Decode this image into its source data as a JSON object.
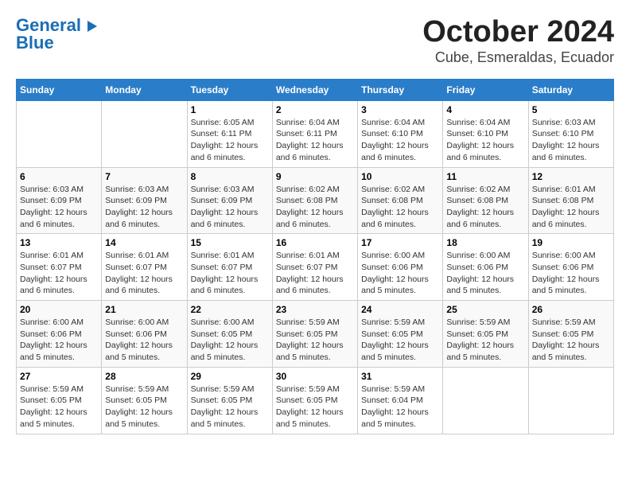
{
  "logo": {
    "line1": "General",
    "line2": "Blue"
  },
  "title": "October 2024",
  "subtitle": "Cube, Esmeraldas, Ecuador",
  "weekdays": [
    "Sunday",
    "Monday",
    "Tuesday",
    "Wednesday",
    "Thursday",
    "Friday",
    "Saturday"
  ],
  "weeks": [
    [
      null,
      null,
      {
        "day": 1,
        "sunrise": "6:05 AM",
        "sunset": "6:11 PM",
        "daylight": "12 hours and 6 minutes."
      },
      {
        "day": 2,
        "sunrise": "6:04 AM",
        "sunset": "6:11 PM",
        "daylight": "12 hours and 6 minutes."
      },
      {
        "day": 3,
        "sunrise": "6:04 AM",
        "sunset": "6:10 PM",
        "daylight": "12 hours and 6 minutes."
      },
      {
        "day": 4,
        "sunrise": "6:04 AM",
        "sunset": "6:10 PM",
        "daylight": "12 hours and 6 minutes."
      },
      {
        "day": 5,
        "sunrise": "6:03 AM",
        "sunset": "6:10 PM",
        "daylight": "12 hours and 6 minutes."
      }
    ],
    [
      {
        "day": 6,
        "sunrise": "6:03 AM",
        "sunset": "6:09 PM",
        "daylight": "12 hours and 6 minutes."
      },
      {
        "day": 7,
        "sunrise": "6:03 AM",
        "sunset": "6:09 PM",
        "daylight": "12 hours and 6 minutes."
      },
      {
        "day": 8,
        "sunrise": "6:03 AM",
        "sunset": "6:09 PM",
        "daylight": "12 hours and 6 minutes."
      },
      {
        "day": 9,
        "sunrise": "6:02 AM",
        "sunset": "6:08 PM",
        "daylight": "12 hours and 6 minutes."
      },
      {
        "day": 10,
        "sunrise": "6:02 AM",
        "sunset": "6:08 PM",
        "daylight": "12 hours and 6 minutes."
      },
      {
        "day": 11,
        "sunrise": "6:02 AM",
        "sunset": "6:08 PM",
        "daylight": "12 hours and 6 minutes."
      },
      {
        "day": 12,
        "sunrise": "6:01 AM",
        "sunset": "6:08 PM",
        "daylight": "12 hours and 6 minutes."
      }
    ],
    [
      {
        "day": 13,
        "sunrise": "6:01 AM",
        "sunset": "6:07 PM",
        "daylight": "12 hours and 6 minutes."
      },
      {
        "day": 14,
        "sunrise": "6:01 AM",
        "sunset": "6:07 PM",
        "daylight": "12 hours and 6 minutes."
      },
      {
        "day": 15,
        "sunrise": "6:01 AM",
        "sunset": "6:07 PM",
        "daylight": "12 hours and 6 minutes."
      },
      {
        "day": 16,
        "sunrise": "6:01 AM",
        "sunset": "6:07 PM",
        "daylight": "12 hours and 6 minutes."
      },
      {
        "day": 17,
        "sunrise": "6:00 AM",
        "sunset": "6:06 PM",
        "daylight": "12 hours and 5 minutes."
      },
      {
        "day": 18,
        "sunrise": "6:00 AM",
        "sunset": "6:06 PM",
        "daylight": "12 hours and 5 minutes."
      },
      {
        "day": 19,
        "sunrise": "6:00 AM",
        "sunset": "6:06 PM",
        "daylight": "12 hours and 5 minutes."
      }
    ],
    [
      {
        "day": 20,
        "sunrise": "6:00 AM",
        "sunset": "6:06 PM",
        "daylight": "12 hours and 5 minutes."
      },
      {
        "day": 21,
        "sunrise": "6:00 AM",
        "sunset": "6:06 PM",
        "daylight": "12 hours and 5 minutes."
      },
      {
        "day": 22,
        "sunrise": "6:00 AM",
        "sunset": "6:05 PM",
        "daylight": "12 hours and 5 minutes."
      },
      {
        "day": 23,
        "sunrise": "5:59 AM",
        "sunset": "6:05 PM",
        "daylight": "12 hours and 5 minutes."
      },
      {
        "day": 24,
        "sunrise": "5:59 AM",
        "sunset": "6:05 PM",
        "daylight": "12 hours and 5 minutes."
      },
      {
        "day": 25,
        "sunrise": "5:59 AM",
        "sunset": "6:05 PM",
        "daylight": "12 hours and 5 minutes."
      },
      {
        "day": 26,
        "sunrise": "5:59 AM",
        "sunset": "6:05 PM",
        "daylight": "12 hours and 5 minutes."
      }
    ],
    [
      {
        "day": 27,
        "sunrise": "5:59 AM",
        "sunset": "6:05 PM",
        "daylight": "12 hours and 5 minutes."
      },
      {
        "day": 28,
        "sunrise": "5:59 AM",
        "sunset": "6:05 PM",
        "daylight": "12 hours and 5 minutes."
      },
      {
        "day": 29,
        "sunrise": "5:59 AM",
        "sunset": "6:05 PM",
        "daylight": "12 hours and 5 minutes."
      },
      {
        "day": 30,
        "sunrise": "5:59 AM",
        "sunset": "6:05 PM",
        "daylight": "12 hours and 5 minutes."
      },
      {
        "day": 31,
        "sunrise": "5:59 AM",
        "sunset": "6:04 PM",
        "daylight": "12 hours and 5 minutes."
      },
      null,
      null
    ]
  ]
}
